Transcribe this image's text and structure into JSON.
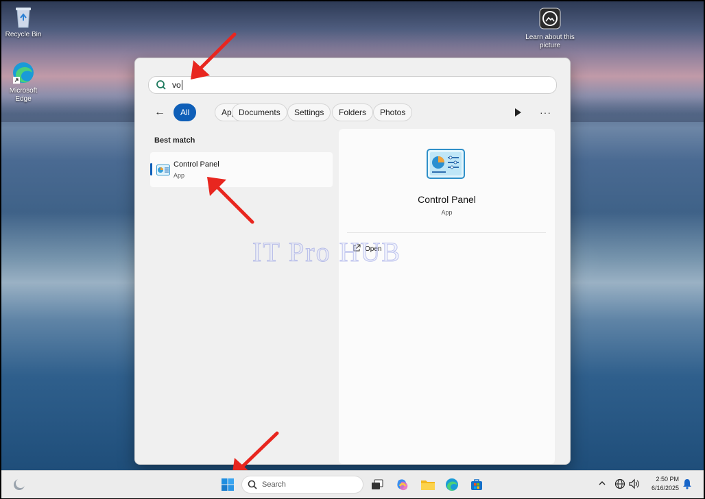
{
  "desktop": {
    "icons": [
      {
        "label": "Recycle Bin"
      },
      {
        "label": "Microsoft Edge"
      },
      {
        "label": "Learn about this picture"
      }
    ]
  },
  "start": {
    "search_value": "vo",
    "filters": [
      "All",
      "Apps",
      "Documents",
      "Settings",
      "Folders",
      "Photos"
    ],
    "active_filter": "All",
    "best_match_label": "Best match",
    "result": {
      "title": "Control Panel",
      "subtitle": "App"
    },
    "detail": {
      "title": "Control Panel",
      "subtitle": "App",
      "action_open": "Open"
    }
  },
  "watermark": "IT Pro HUB",
  "taskbar": {
    "search_placeholder": "Search",
    "time": "2:50 PM",
    "date": "6/16/2025"
  },
  "colors": {
    "accent": "#0f5fb8",
    "annotation_arrow": "#e8261f"
  }
}
